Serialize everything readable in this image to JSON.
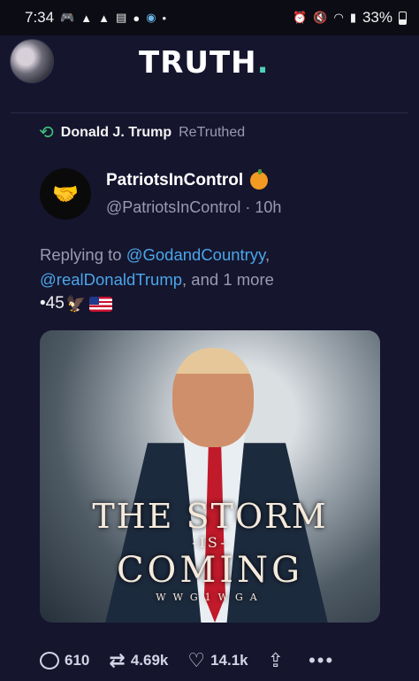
{
  "status_bar": {
    "time": "7:34",
    "battery": "33%",
    "left_icons": [
      "gamepad-icon",
      "warning-icon",
      "warning-icon",
      "calendar-icon",
      "account-icon",
      "location-icon",
      "dot-icon"
    ],
    "right_icons": [
      "alarm-icon",
      "mute-icon",
      "wifi-icon",
      "signal-icon"
    ]
  },
  "header": {
    "logo": "TRUTH",
    "logo_dot": ".",
    "accent_color": "#4fd1b8"
  },
  "post": {
    "retruth_user": "Donald J. Trump",
    "retruth_suffix": "ReTruthed",
    "author_name": "PatriotsInControl",
    "author_handle": "@PatriotsInControl · 10h",
    "reply_prefix": "Replying to ",
    "mentions": [
      "@GodandCountryy",
      "@realDonaldTrump"
    ],
    "reply_sep": ",",
    "reply_suffix": ", and 1 more",
    "tagline": "•45",
    "media": {
      "line1": "THE STORM",
      "line2": "-IS-",
      "line3": "COMING",
      "line4": "WWG1WGA"
    }
  },
  "actions": {
    "replies": "610",
    "retruths": "4.69k",
    "likes": "14.1k"
  }
}
